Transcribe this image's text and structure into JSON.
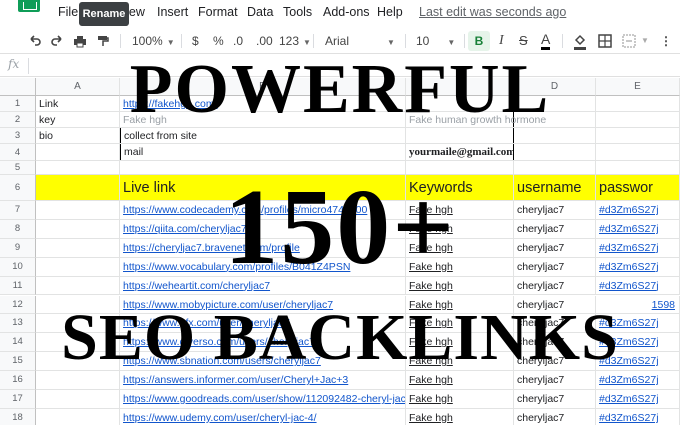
{
  "menu": {
    "items": [
      "File",
      "Edit",
      "View",
      "Insert",
      "Format",
      "Data",
      "Tools",
      "Add-ons",
      "Help"
    ],
    "tooltip": "Rename",
    "last_edit": "Last edit was seconds ago"
  },
  "toolbar": {
    "zoom": "100%",
    "currency": "$",
    "percent": "%",
    "decrease_decimal": ".0",
    "increase_decimal": ".00",
    "number_format": "123",
    "font": "Arial",
    "font_size": "10",
    "bold": "B",
    "italic": "I",
    "strike": "S",
    "text_color": "A"
  },
  "formula_bar": {
    "fx": "fx"
  },
  "grid": {
    "columns": [
      "A",
      "B",
      "C",
      "D",
      "E"
    ],
    "rows": [
      {
        "num": "1",
        "a": "Link",
        "b": "https://fakehgh.com/",
        "c": "",
        "d": "",
        "e": ""
      },
      {
        "num": "2",
        "a": "key",
        "b": "Fake hgh",
        "c": "Fake human growth hormone",
        "d": "",
        "e": ""
      },
      {
        "num": "3",
        "a": "bio",
        "b": "collect from site",
        "c": "",
        "d": "",
        "e": ""
      },
      {
        "num": "4",
        "a": "",
        "b": "mail",
        "c": "yourmaile@gmail.com",
        "d": "",
        "e": ""
      },
      {
        "num": "5",
        "a": "",
        "b": "",
        "c": "",
        "d": "",
        "e": ""
      },
      {
        "num": "6",
        "a": "",
        "b": "Live link",
        "c": "Keywords",
        "d": "username",
        "e": "passwor"
      },
      {
        "num": "7",
        "a": "",
        "b": "https://www.codecademy.com/profiles/micro4749800",
        "c": "Fake hgh",
        "d": "cheryljac7",
        "e": "#d3Zm6S27j"
      },
      {
        "num": "8",
        "a": "",
        "b": "https://qiita.com/cheryljac7",
        "c": "Fake hgh",
        "d": "cheryljac7",
        "e": "#d3Zm6S27j"
      },
      {
        "num": "9",
        "a": "",
        "b": "https://cheryljac7.bravenet.com/profile",
        "c": "Fake hgh",
        "d": "cheryljac7",
        "e": "#d3Zm6S27j"
      },
      {
        "num": "10",
        "a": "",
        "b": "https://www.vocabulary.com/profiles/B041Z4PSN",
        "c": "Fake hgh",
        "d": "cheryljac7",
        "e": "#d3Zm6S27j"
      },
      {
        "num": "11",
        "a": "",
        "b": "https://weheartit.com/cheryljac7",
        "c": "Fake hgh",
        "d": "cheryljac7",
        "e": "#d3Zm6S27j"
      },
      {
        "num": "12",
        "a": "",
        "b": "https://www.mobypicture.com/user/cheryljac7",
        "c": "Fake hgh",
        "d": "cheryljac7",
        "e": "1598"
      },
      {
        "num": "13",
        "a": "",
        "b": "https://www.gfx.com/user/cheryljac7",
        "c": "Fake hgh",
        "d": "cheryljac7",
        "e": "#d3Zm6S27j"
      },
      {
        "num": "14",
        "a": "",
        "b": "https://www.diverso.com/users/cheryljac7",
        "c": "Fake hgh",
        "d": "cheryljac7",
        "e": "#d3Zm6S27j"
      },
      {
        "num": "15",
        "a": "",
        "b": "https://www.sbnation.com/users/cheryljac7",
        "c": "Fake hgh",
        "d": "cheryljac7",
        "e": "#d3Zm6S27j"
      },
      {
        "num": "16",
        "a": "",
        "b": "https://answers.informer.com/user/Cheryl+Jac+3",
        "c": "Fake hgh",
        "d": "cheryljac7",
        "e": "#d3Zm6S27j"
      },
      {
        "num": "17",
        "a": "",
        "b": "https://www.goodreads.com/user/show/112092482-cheryl-jac",
        "c": "Fake hgh",
        "d": "cheryljac7",
        "e": "#d3Zm6S27j"
      },
      {
        "num": "18",
        "a": "",
        "b": "https://www.udemy.com/user/cheryl-jac-4/",
        "c": "Fake hgh",
        "d": "cheryljac7",
        "e": "#d3Zm6S27j"
      }
    ]
  },
  "overlay": {
    "line1": "POWERFUL",
    "line2": "150+",
    "line3": "SEO BACKLINKS"
  },
  "colors": {
    "header_highlight": "#ffff00",
    "link": "#1155cc",
    "sheets_green": "#0f9d58"
  }
}
